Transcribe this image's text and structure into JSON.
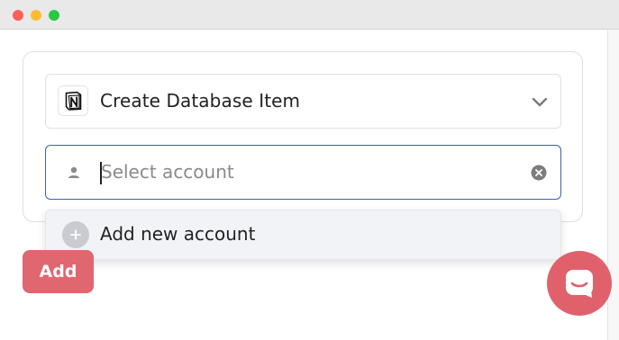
{
  "window": {
    "traffic_lights": [
      "close",
      "minimize",
      "maximize"
    ]
  },
  "action": {
    "app_icon": "notion-logo-icon",
    "label": "Create Database Item",
    "dropdown_icon": "chevron-down-icon"
  },
  "account": {
    "placeholder": "Select account",
    "leading_icon": "person-icon",
    "clear_icon": "clear-circle-icon"
  },
  "account_menu": {
    "items": [
      {
        "label": "Add new account",
        "icon": "plus-circle-icon"
      }
    ]
  },
  "footer": {
    "add_label": "Add"
  },
  "chat": {
    "icon": "chat-bubble-icon"
  },
  "colors": {
    "accent": "#e06670",
    "input_focus_border": "#3d5fb5",
    "chat_launcher": "#e0616c"
  }
}
